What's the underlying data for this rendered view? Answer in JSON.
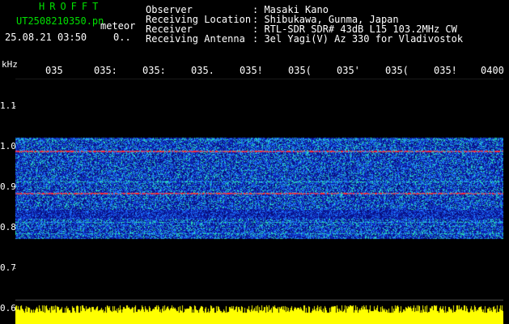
{
  "header": {
    "brand": "HROFFT",
    "file_name": "UT2508210350.pn",
    "file_type": "meteor",
    "datetime": "25.08.21 03:50",
    "value": "0.."
  },
  "info": [
    {
      "label": "Observer",
      "value": ": Masaki Kano"
    },
    {
      "label": "Receiving Location",
      "value": ": Shibukawa, Gunma, Japan"
    },
    {
      "label": "Receiver",
      "value": ": RTL-SDR SDR# 43dB L15 103.2MHz CW"
    },
    {
      "label": "Receiving Antenna",
      "value": ": 3el Yagi(V) Az 330 for Vladivostok"
    }
  ],
  "axis": {
    "y_unit": "kHz",
    "x_ticks": [
      "035",
      "035:",
      "035:",
      "035.",
      "035!",
      "035(",
      "035'",
      "035(",
      "035!",
      "0400"
    ],
    "y_ticks": [
      "1.1",
      "1.0",
      "0.9",
      "0.8",
      "0.7",
      "0.6"
    ]
  },
  "colors": {
    "background": "#000000",
    "noise_low": "#1010a0",
    "noise_mid": "#2080ff",
    "noise_high": "#30e0c0",
    "signal": "#ff2030",
    "level_bar": "#ffff00"
  }
}
